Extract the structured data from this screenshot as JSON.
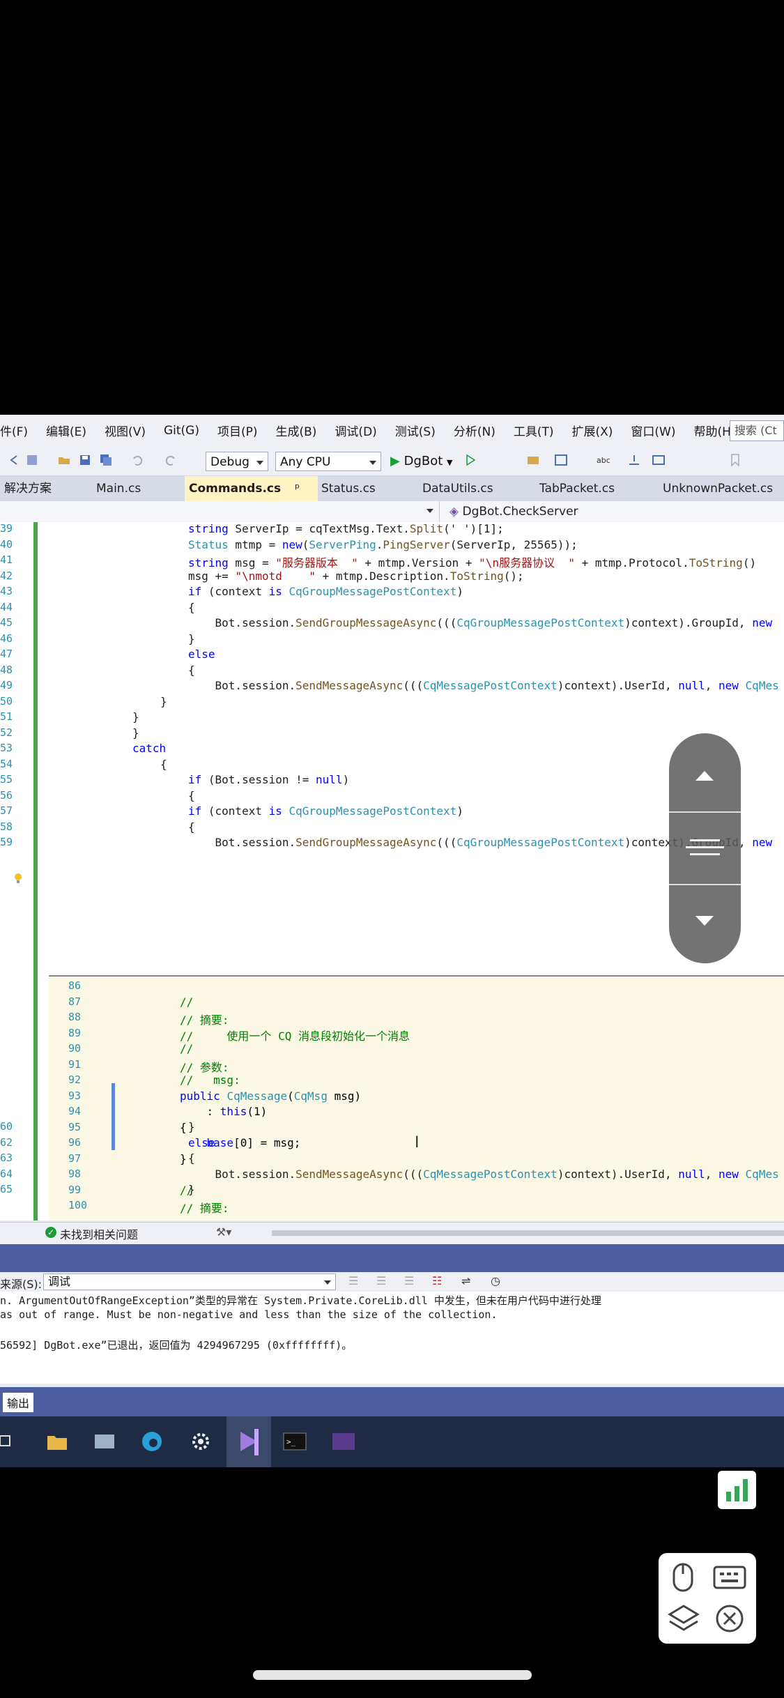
{
  "menu": [
    "件(F)",
    "编辑(E)",
    "视图(V)",
    "Git(G)",
    "项目(P)",
    "生成(B)",
    "调试(D)",
    "测试(S)",
    "分析(N)",
    "工具(T)",
    "扩展(X)",
    "窗口(W)",
    "帮助(H)"
  ],
  "search_placeholder": "搜索 (Ct",
  "toolbar": {
    "config": "Debug",
    "platform": "Any CPU",
    "run_target": "DgBot"
  },
  "tabs": {
    "solution": "解决方案",
    "main": "Main.cs",
    "commands": "Commands.cs",
    "pin": "ᵖ",
    "status": "Status.cs",
    "datautils": "DataUtils.cs",
    "tabpacket": "TabPacket.cs",
    "unknown": "UnknownPacket.cs"
  },
  "navbar": {
    "member": "DgBot.CheckServer"
  },
  "editor_lines": [
    {
      "n": "39",
      "t": "string ServerIp = cqTextMsg.Text.Split(' ')[1];"
    },
    {
      "n": "40",
      "t": "Status mtmp = new(ServerPing.PingServer(ServerIp, 25565));"
    },
    {
      "n": "41",
      "t": "string msg = \"服务器版本  \" + mtmp.Version + \"\\n服务器协议  \" + mtmp.Protocol.ToString()"
    },
    {
      "n": "42",
      "t": "msg += \"\\nmotd    \" + mtmp.Description.ToString();"
    },
    {
      "n": "43",
      "t": "if (context is CqGroupMessagePostContext)"
    },
    {
      "n": "44",
      "t": "{"
    },
    {
      "n": "45",
      "t": "    Bot.session.SendGroupMessageAsync(((CqGroupMessagePostContext)context).GroupId, new"
    },
    {
      "n": "46",
      "t": "}"
    },
    {
      "n": "47",
      "t": "else"
    },
    {
      "n": "48",
      "t": "{"
    },
    {
      "n": "49",
      "t": "    Bot.session.SendMessageAsync(((CqMessagePostContext)context).UserId, null, new CqMes"
    },
    {
      "n": "50",
      "t": "}"
    },
    {
      "n": "51",
      "t": "}"
    },
    {
      "n": "52",
      "t": "}"
    },
    {
      "n": "53",
      "t": "catch"
    },
    {
      "n": "54",
      "t": "{"
    },
    {
      "n": "55",
      "t": "if (Bot.session != null)"
    },
    {
      "n": "56",
      "t": "{"
    },
    {
      "n": "57",
      "t": "if (context is CqGroupMessagePostContext)"
    },
    {
      "n": "58",
      "t": "{"
    },
    {
      "n": "59",
      "t": "    Bot.session.SendGroupMessageAsync(((CqGroupMessagePostContext)context).GroupId, new"
    }
  ],
  "peek_lines": [
    {
      "n": "86",
      "t": ""
    },
    {
      "n": "87",
      "t": "//"
    },
    {
      "n": "88",
      "t": "// 摘要:"
    },
    {
      "n": "89",
      "t": "//     使用一个 CQ 消息段初始化一个消息"
    },
    {
      "n": "90",
      "t": "//"
    },
    {
      "n": "91",
      "t": "// 参数:"
    },
    {
      "n": "92",
      "t": "//   msg:"
    },
    {
      "n": "93",
      "t": "public CqMessage(CqMsg msg)"
    },
    {
      "n": "94",
      "t": "    : this(1)"
    },
    {
      "n": "95",
      "t": "{"
    },
    {
      "n": "96",
      "t": "    base[0] = msg;"
    },
    {
      "n": "97",
      "t": "}"
    },
    {
      "n": "98",
      "t": ""
    },
    {
      "n": "99",
      "t": "//"
    },
    {
      "n": "100",
      "t": "// 摘要:"
    }
  ],
  "after_lines": [
    {
      "n": "60",
      "t": "}"
    },
    {
      "n": "62",
      "t": "else"
    },
    {
      "n": "63",
      "t": "{"
    },
    {
      "n": "64",
      "t": "    Bot.session.SendMessageAsync(((CqMessagePostContext)context).UserId, null, new CqMes"
    },
    {
      "n": "65",
      "t": "}"
    }
  ],
  "status": {
    "issues": "未找到相关问题"
  },
  "output": {
    "source_label": "来源(S):",
    "source_value": "调试",
    "line1": "n. ArgumentOutOfRangeException”类型的异常在 System.Private.CoreLib.dll 中发生，但未在用户代码中进行处理",
    "line2": "as out of range. Must be non-negative and less than the size of the collection.",
    "line3": "56592] DgBot.exe”已退出，返回值为 4294967295 (0xffffffff)。",
    "tab": "输出"
  },
  "colors": {
    "accent": "#4c5ea0",
    "active_tab": "#fff3c4",
    "peek_bg": "#fbf9e5"
  }
}
